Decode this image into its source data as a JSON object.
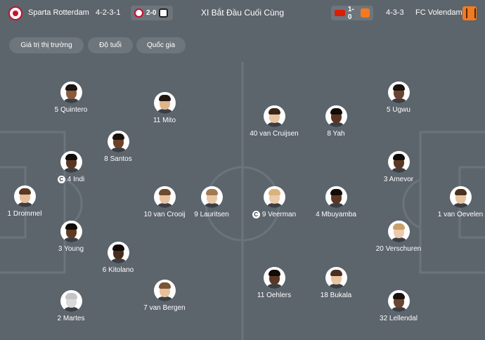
{
  "header": {
    "home_team": "Sparta Rotterdam",
    "home_formation": "4-2-3-1",
    "home_last_score": "2-0",
    "title": "XI Bắt Đầu Cuối Cùng",
    "away_last_score": "1-0",
    "away_formation": "4-3-3",
    "away_team": "FC Volendam"
  },
  "filters": [
    "Giá trị thị trường",
    "Độ tuổi",
    "Quốc gia"
  ],
  "colors": {
    "background": "#5c646c",
    "chip": "#6e767d",
    "pitch_line": "#6c747b"
  },
  "captain_mark": "C",
  "home_players": [
    {
      "label": "5 Quintero",
      "skin": "#8a5a3c",
      "hair": "#1b1410",
      "captain": false
    },
    {
      "label": "11 Mito",
      "skin": "#e0b48c",
      "hair": "#201612",
      "captain": false
    },
    {
      "label": "8 Santos",
      "skin": "#6b4128",
      "hair": "#1a120d",
      "captain": false
    },
    {
      "label": "4 Indi",
      "skin": "#5a3521",
      "hair": "#120c08",
      "captain": true
    },
    {
      "label": "1 Drommel",
      "skin": "#e6bf9a",
      "hair": "#5a3a24",
      "captain": false
    },
    {
      "label": "10 van Crooij",
      "skin": "#e8c2a0",
      "hair": "#6b4a2e",
      "captain": false
    },
    {
      "label": "9 Lauritsen",
      "skin": "#e9c6a6",
      "hair": "#a27a52",
      "captain": false
    },
    {
      "label": "3 Young",
      "skin": "#5e3a24",
      "hair": "#120c08",
      "captain": false
    },
    {
      "label": "6 Kitolano",
      "skin": "#4a2c1c",
      "hair": "#0f0a07",
      "captain": false
    },
    {
      "label": "7 van Bergen",
      "skin": "#e6c09c",
      "hair": "#7a5434",
      "captain": false
    },
    {
      "label": "2 Martes",
      "skin": "#d9d9d9",
      "hair": "#c4c4c4",
      "captain": false
    }
  ],
  "away_players": [
    {
      "label": "5 Ugwu",
      "skin": "#6a4430",
      "hair": "#1a120d",
      "captain": false
    },
    {
      "label": "40 van Cruijsen",
      "skin": "#e8c4a2",
      "hair": "#3a2618",
      "captain": false
    },
    {
      "label": "8 Yah",
      "skin": "#5a3522",
      "hair": "#120c08",
      "captain": false
    },
    {
      "label": "3 Amevor",
      "skin": "#5b3824",
      "hair": "#120c08",
      "captain": false
    },
    {
      "label": "9 Veerman",
      "skin": "#ecc9aa",
      "hair": "#d9b27a",
      "captain": true
    },
    {
      "label": "4 Mbuyamba",
      "skin": "#5a3724",
      "hair": "#120c08",
      "captain": false
    },
    {
      "label": "1 van Oevelen",
      "skin": "#e6c2a0",
      "hair": "#4a3020",
      "captain": false
    },
    {
      "label": "20 Verschuren",
      "skin": "#ecc9aa",
      "hair": "#c9a06a",
      "captain": false
    },
    {
      "label": "11 Oehlers",
      "skin": "#5a3724",
      "hair": "#120c08",
      "captain": false
    },
    {
      "label": "18 Bukala",
      "skin": "#e8c4a2",
      "hair": "#4a3020",
      "captain": false
    },
    {
      "label": "32 Lellendal",
      "skin": "#6a4430",
      "hair": "#1a120d",
      "captain": false
    }
  ]
}
